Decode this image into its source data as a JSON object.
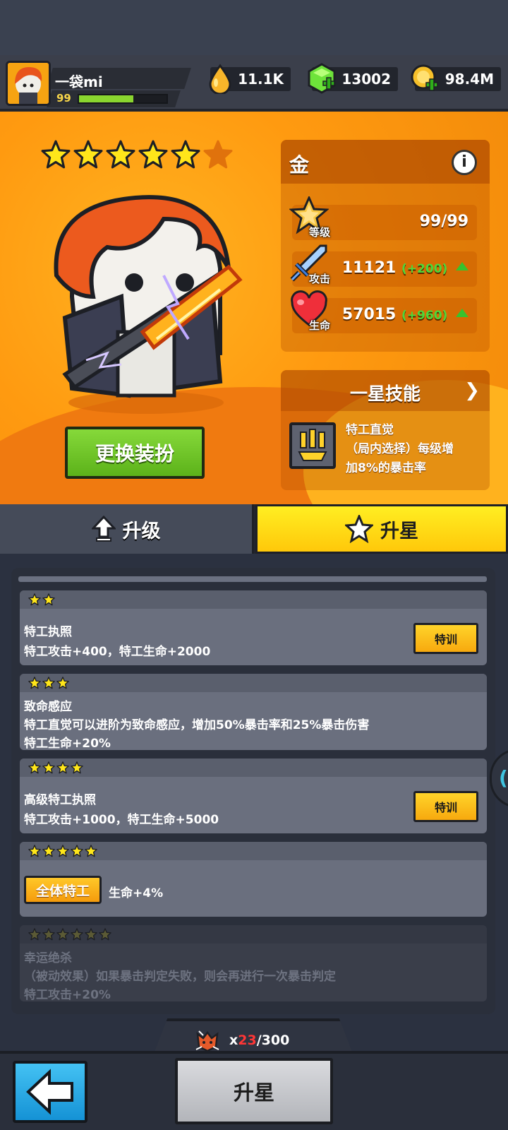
{
  "player": {
    "name": "一袋mi",
    "level": "99",
    "xp_fraction": 0.62
  },
  "resources": {
    "oil": "11.1K",
    "gems": "13002",
    "gold": "98.4M"
  },
  "hero": {
    "stars_filled": 5,
    "stars_total": 6,
    "outfit_button": "更换装扮",
    "stats_title": "金",
    "info_label": "i",
    "level_label": "等级",
    "level_value": "99/99",
    "attack_label": "攻击",
    "attack_value": "11121",
    "attack_bonus": "(+200)",
    "hp_label": "生命",
    "hp_value": "57015",
    "hp_bonus": "(+960)",
    "skill_header": "一星技能",
    "skill_line1": "特工直觉",
    "skill_line2": "（局内选择）每级增",
    "skill_line3": "加8%的暴击率"
  },
  "tabs": {
    "upgrade": "升级",
    "star_up": "升星"
  },
  "star_rewards": [
    {
      "stars": 2,
      "title": "特工执照",
      "line1": "特工攻击+400，特工生命+2000",
      "line2": "",
      "button": "特训",
      "locked": false
    },
    {
      "stars": 3,
      "title": "致命感应",
      "line1": "特工直觉可以进阶为致命感应，增加50%暴击率和25%暴击伤害",
      "line2": "特工生命+20%",
      "button": "",
      "locked": false
    },
    {
      "stars": 4,
      "title": "高级特工执照",
      "line1": "特工攻击+1000，特工生命+5000",
      "line2": "",
      "button": "特训",
      "locked": false
    },
    {
      "stars": 5,
      "title": "",
      "chip": "全体特工",
      "line1": "生命+4%",
      "line2": "",
      "button": "",
      "locked": false
    },
    {
      "stars": 6,
      "title": "幸运绝杀",
      "line1": "（被动效果）如果暴击判定失败，则会再进行一次暴击判定",
      "line2": "特工攻击+20%",
      "button": "",
      "locked": true
    }
  ],
  "cost": {
    "prefix": "x",
    "have": "23",
    "need": "/300"
  },
  "bottom": {
    "star_up_button": "升星"
  },
  "colors": {
    "accent": "#ffc80a",
    "hero_bg": "#ff9a10",
    "positive": "#4cd83a",
    "deficit": "#ff3636"
  }
}
